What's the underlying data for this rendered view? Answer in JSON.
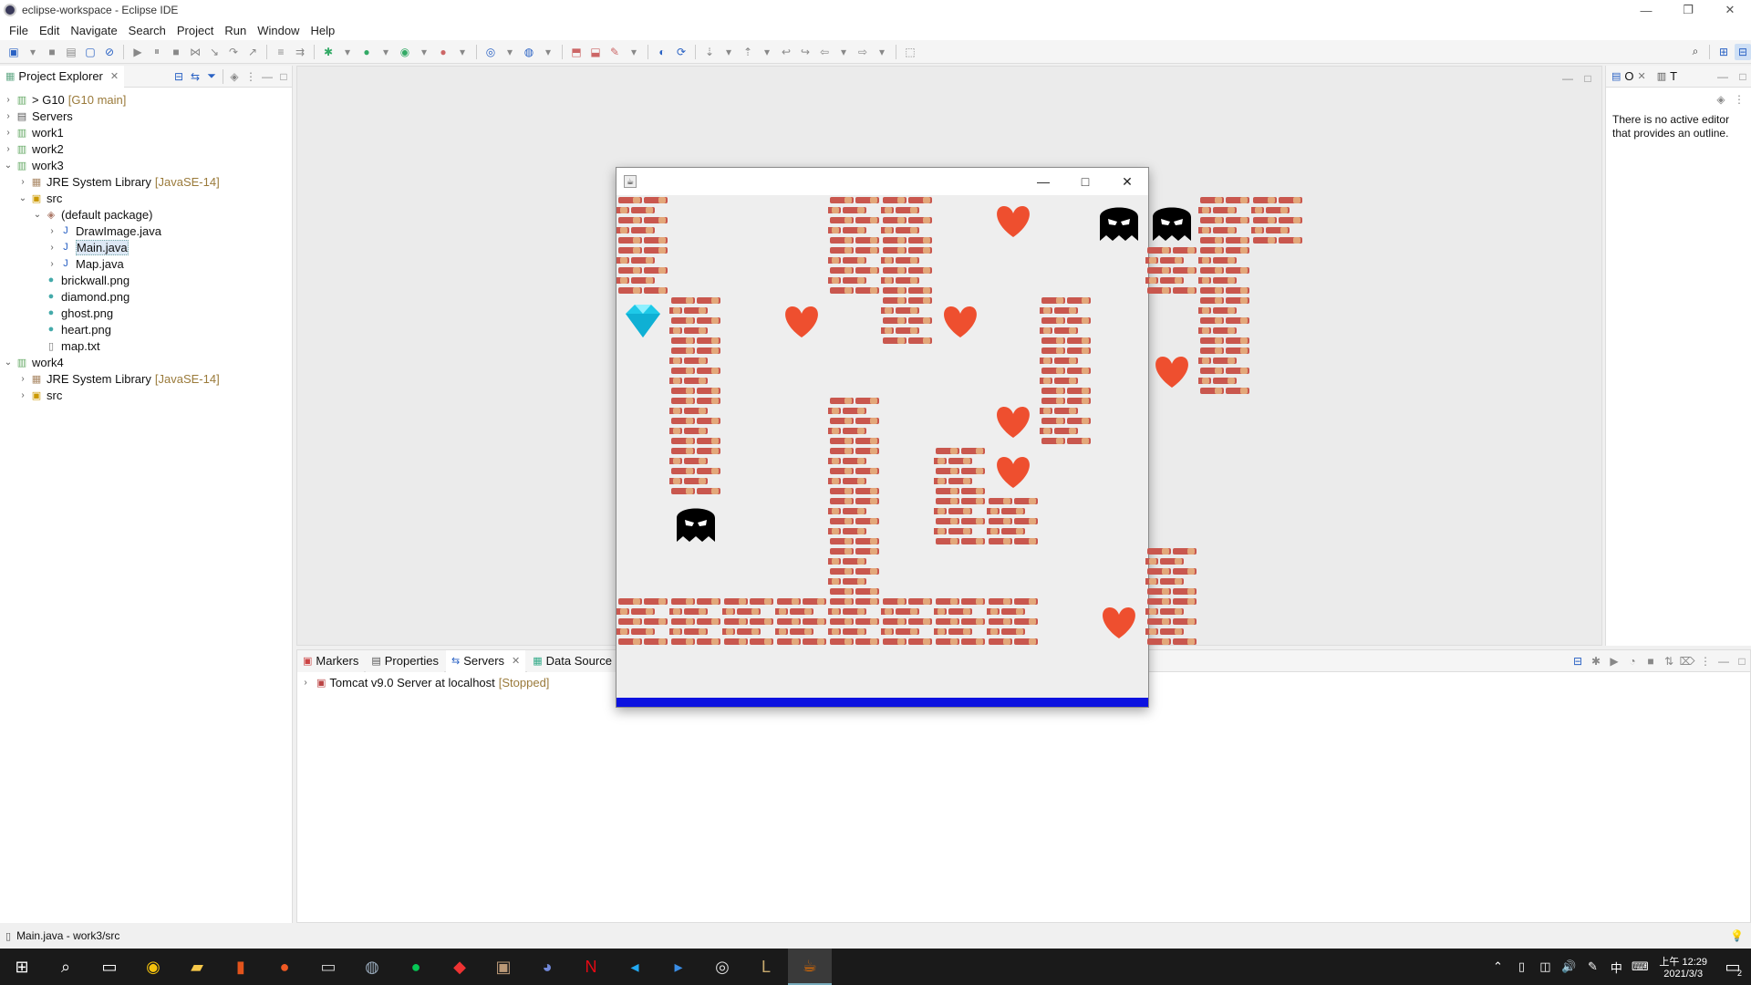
{
  "window": {
    "title": "eclipse-workspace - Eclipse IDE"
  },
  "menu": [
    "File",
    "Edit",
    "Navigate",
    "Search",
    "Project",
    "Run",
    "Window",
    "Help"
  ],
  "project_explorer": {
    "tab_label": "Project Explorer",
    "rows": [
      {
        "label": "> G10",
        "extra": "[G10 main]",
        "icon": "project-icon",
        "depth": 0,
        "expanded": false
      },
      {
        "label": "Servers",
        "extra": "",
        "icon": "folder-icon",
        "depth": 0,
        "expanded": false
      },
      {
        "label": "work1",
        "extra": "",
        "icon": "project-icon",
        "depth": 0,
        "expanded": false
      },
      {
        "label": "work2",
        "extra": "",
        "icon": "project-icon",
        "depth": 0,
        "expanded": false
      },
      {
        "label": "work3",
        "extra": "",
        "icon": "project-icon",
        "depth": 0,
        "expanded": true
      },
      {
        "label": "JRE System Library",
        "extra": "[JavaSE-14]",
        "icon": "library-icon",
        "depth": 1,
        "expanded": false
      },
      {
        "label": "src",
        "extra": "",
        "icon": "source-folder-icon",
        "depth": 1,
        "expanded": true
      },
      {
        "label": "(default package)",
        "extra": "",
        "icon": "package-icon",
        "depth": 2,
        "expanded": true
      },
      {
        "label": "DrawImage.java",
        "extra": "",
        "icon": "java-file-icon",
        "depth": 3,
        "expanded": false
      },
      {
        "label": "Main.java",
        "extra": "",
        "icon": "java-file-icon",
        "depth": 3,
        "expanded": false,
        "selected": true
      },
      {
        "label": "Map.java",
        "extra": "",
        "icon": "java-file-icon",
        "depth": 3,
        "expanded": false
      },
      {
        "label": "brickwall.png",
        "extra": "",
        "icon": "image-file-icon",
        "depth": 2,
        "leaf": true
      },
      {
        "label": "diamond.png",
        "extra": "",
        "icon": "image-file-icon",
        "depth": 2,
        "leaf": true
      },
      {
        "label": "ghost.png",
        "extra": "",
        "icon": "image-file-icon",
        "depth": 2,
        "leaf": true
      },
      {
        "label": "heart.png",
        "extra": "",
        "icon": "image-file-icon",
        "depth": 2,
        "leaf": true
      },
      {
        "label": "map.txt",
        "extra": "",
        "icon": "text-file-icon",
        "depth": 2,
        "leaf": true
      },
      {
        "label": "work4",
        "extra": "",
        "icon": "project-icon",
        "depth": 0,
        "expanded": true
      },
      {
        "label": "JRE System Library",
        "extra": "[JavaSE-14]",
        "icon": "library-icon",
        "depth": 1,
        "expanded": false
      },
      {
        "label": "src",
        "extra": "",
        "icon": "source-folder-icon",
        "depth": 1,
        "expanded": false
      }
    ]
  },
  "outline": {
    "tab1": "O",
    "tab2": "T",
    "message": "There is no active editor that provides an outline."
  },
  "bottom_panel": {
    "tabs": [
      "Markers",
      "Properties",
      "Servers",
      "Data Source"
    ],
    "active_tab": "Servers",
    "server_row": {
      "name": "Tomcat v9.0 Server at localhost",
      "state": "[Stopped]"
    }
  },
  "status": {
    "text": "Main.java - work3/src"
  },
  "taskbar": {
    "time": "上午 12:29",
    "date": "2021/3/3",
    "ime": "中",
    "notifications": "2"
  },
  "game": {
    "colors": {
      "brick_dark": "#c9574e",
      "brick_light": "#e3a77a",
      "heart": "#ee4f2f",
      "bar": "#0b12e0"
    },
    "grid": [
      "W...WW.H.GGWW",
      "W...WW....WW",
      "DW.H.WH.W..W.",
      ".W......W.HW",
      ".W..W..HW...",
      ".W..W.WH.....",
      ".G..W.WW.....",
      "....W.....W..",
      "WWWWWWWW.HW.."
    ]
  }
}
